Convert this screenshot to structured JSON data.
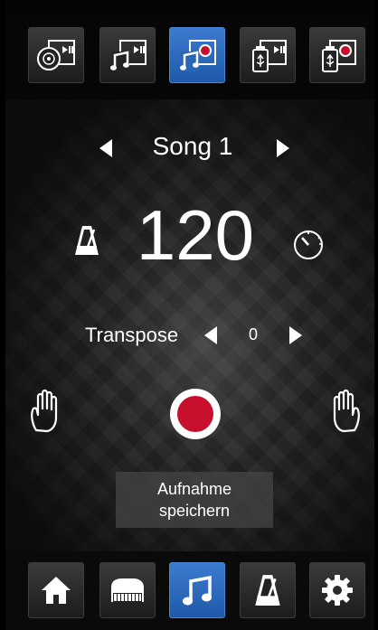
{
  "top_toolbar": {
    "buttons": [
      {
        "icon": "cd-play-icon",
        "active": false
      },
      {
        "icon": "song-play-icon",
        "active": false
      },
      {
        "icon": "song-record-icon",
        "active": true
      },
      {
        "icon": "usb-play-icon",
        "active": false
      },
      {
        "icon": "usb-record-icon",
        "active": false
      }
    ]
  },
  "song": {
    "title": "Song 1"
  },
  "tempo": {
    "value": "120"
  },
  "transpose": {
    "label": "Transpose",
    "value": "0"
  },
  "record": {
    "save_label_line1": "Aufnahme",
    "save_label_line2": "speichern"
  },
  "colors": {
    "accent": "#1e5aa8",
    "record": "#c8102e"
  },
  "bottom_nav": {
    "items": [
      {
        "icon": "home-icon",
        "active": false
      },
      {
        "icon": "piano-icon",
        "active": false
      },
      {
        "icon": "music-note-icon",
        "active": true
      },
      {
        "icon": "metronome-icon",
        "active": false
      },
      {
        "icon": "gear-icon",
        "active": false
      }
    ]
  }
}
